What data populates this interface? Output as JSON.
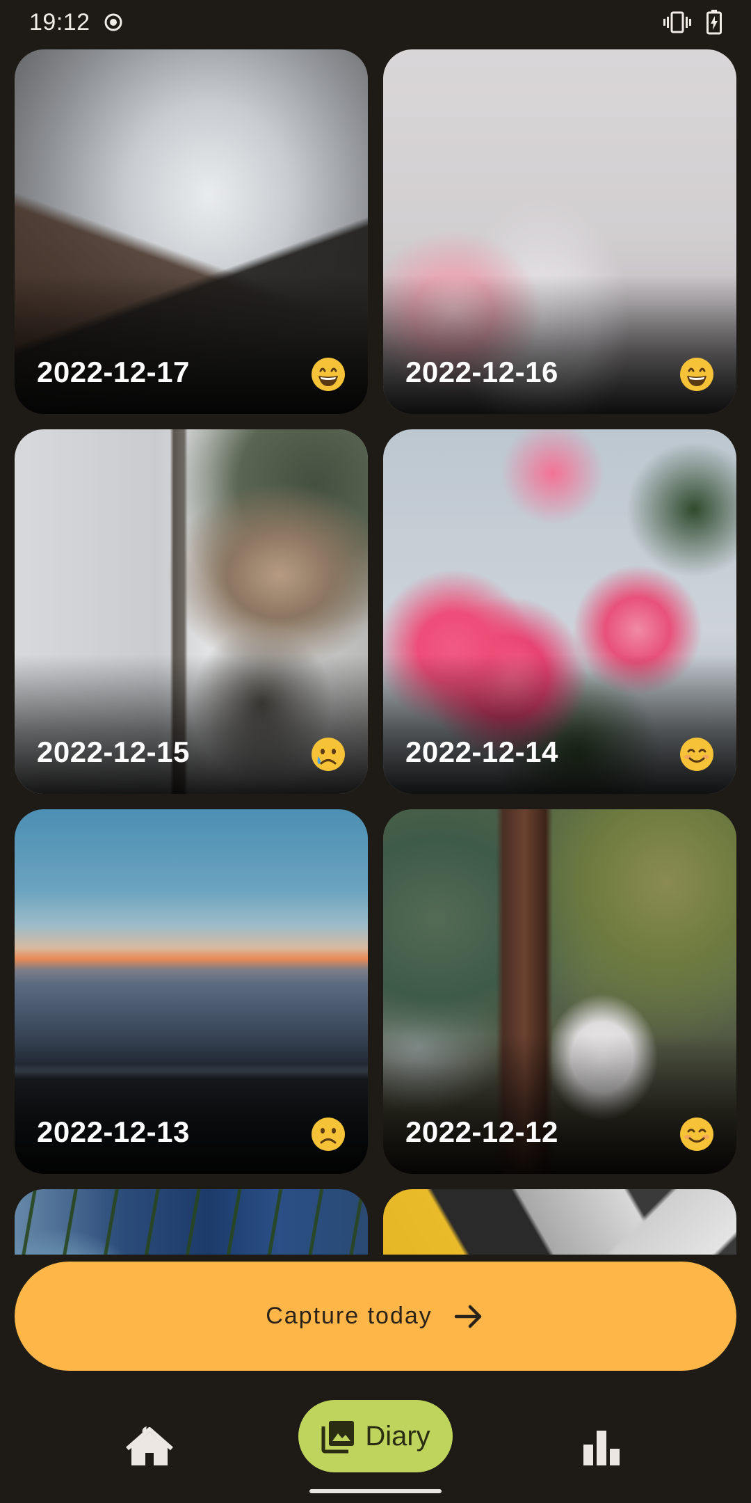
{
  "status_bar": {
    "time": "19:12",
    "icons": [
      "record-icon",
      "vibrate-icon",
      "battery-charging-icon"
    ]
  },
  "entries": [
    {
      "date": "2022-12-17",
      "mood": "grinning",
      "photo": "snowy-forest-road"
    },
    {
      "date": "2022-12-16",
      "mood": "grinning",
      "photo": "pink-teapot"
    },
    {
      "date": "2022-12-15",
      "mood": "crying",
      "photo": "snowy-aerial-road"
    },
    {
      "date": "2022-12-14",
      "mood": "smiling",
      "photo": "pink-flowers"
    },
    {
      "date": "2022-12-13",
      "mood": "frowning",
      "photo": "mountain-sunset"
    },
    {
      "date": "2022-12-12",
      "mood": "smiling",
      "photo": "forest-garden-table"
    },
    {
      "date": "",
      "mood": "",
      "photo": "globe-pine"
    },
    {
      "date": "",
      "mood": "",
      "photo": "abstract-yellow"
    }
  ],
  "capture_button": {
    "label": "Capture today",
    "icon": "arrow-right-icon"
  },
  "nav": {
    "home": {
      "icon": "home-icon"
    },
    "diary": {
      "label": "Diary",
      "icon": "photo-library-icon"
    },
    "stats": {
      "icon": "bar-chart-icon"
    }
  },
  "colors": {
    "background": "#1e1a16",
    "capture_button": "#fdb647",
    "nav_active": "#bed45c",
    "emoji_yellow": "#f6c338"
  }
}
